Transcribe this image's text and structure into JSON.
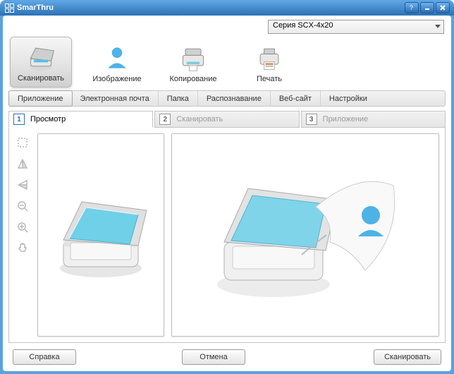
{
  "window": {
    "title": "SmarThru"
  },
  "device": {
    "selected": "Серия SCX-4x20"
  },
  "mainButtons": [
    {
      "label": "Сканировать"
    },
    {
      "label": "Изображение"
    },
    {
      "label": "Копирование"
    },
    {
      "label": "Печать"
    }
  ],
  "subTabs": [
    {
      "label": "Приложение"
    },
    {
      "label": "Электронная почта"
    },
    {
      "label": "Папка"
    },
    {
      "label": "Распознавание"
    },
    {
      "label": "Веб-сайт"
    },
    {
      "label": "Настройки"
    }
  ],
  "stepTabs": [
    {
      "num": "1",
      "label": "Просмотр"
    },
    {
      "num": "2",
      "label": "Сканировать"
    },
    {
      "num": "3",
      "label": "Приложение"
    }
  ],
  "footer": {
    "help": "Справка",
    "cancel": "Отмена",
    "scan": "Сканировать"
  }
}
